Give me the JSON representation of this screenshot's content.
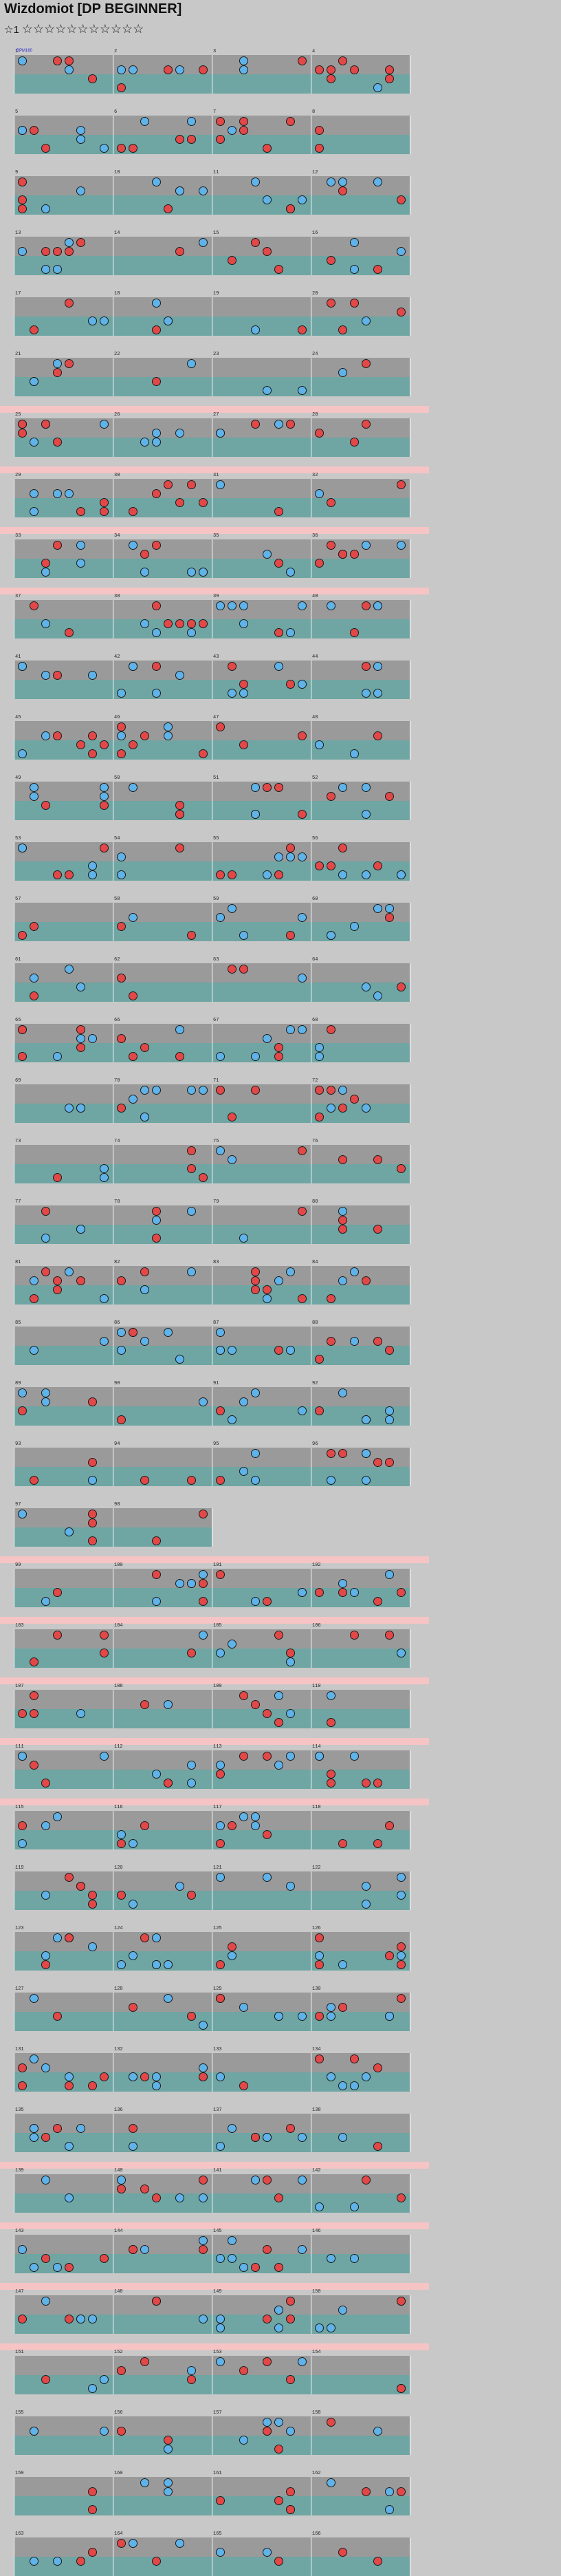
{
  "title": "Wizdomiot [DP BEGINNER]",
  "level": {
    "label": "☆1",
    "stars": "☆☆☆☆☆☆☆☆☆☆☆"
  },
  "colors": {
    "red": "#e24848",
    "blue": "#5fb3e8",
    "cn": "#f2ea2a",
    "pink": "#f6c4c4",
    "lane_top": "#9a9a9a",
    "lane_bottom": "#6fa5a2"
  },
  "bpm_marker": "BPM160",
  "measure_count": 192
}
